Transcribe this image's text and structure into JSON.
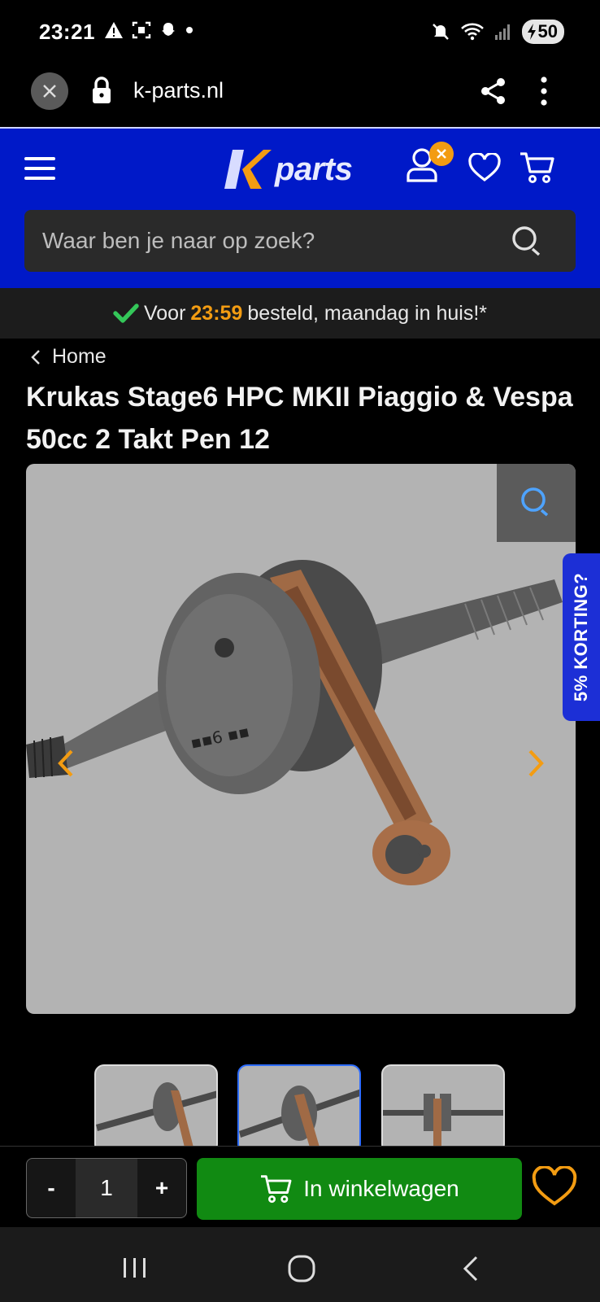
{
  "status_bar": {
    "time": "23:21",
    "battery": "50"
  },
  "browser": {
    "url": "k-parts.nl"
  },
  "site": {
    "logo_text": "parts",
    "search_placeholder": "Waar ben je naar op zoek?"
  },
  "delivery": {
    "prefix": "Voor",
    "time": "23:59",
    "suffix": "besteld, maandag in huis!*"
  },
  "breadcrumb": {
    "home": "Home"
  },
  "product": {
    "title": "Krukas Stage6 HPC MKII Piaggio & Vespa 50cc 2 Takt Pen 12",
    "discount_tab": "5% KORTING?"
  },
  "cart": {
    "minus": "-",
    "quantity": "1",
    "plus": "+",
    "add_label": "In winkelwagen"
  },
  "colors": {
    "brand_blue": "#0019c8",
    "accent_orange": "#f39c12",
    "cart_green": "#118a12"
  },
  "icons": [
    "close-icon",
    "lock-icon",
    "share-icon",
    "more-icon",
    "menu-icon",
    "user-icon",
    "heart-icon",
    "cart-icon",
    "search-icon",
    "check-icon",
    "chevron-left-icon",
    "zoom-icon",
    "arrow-left-icon",
    "arrow-right-icon"
  ]
}
